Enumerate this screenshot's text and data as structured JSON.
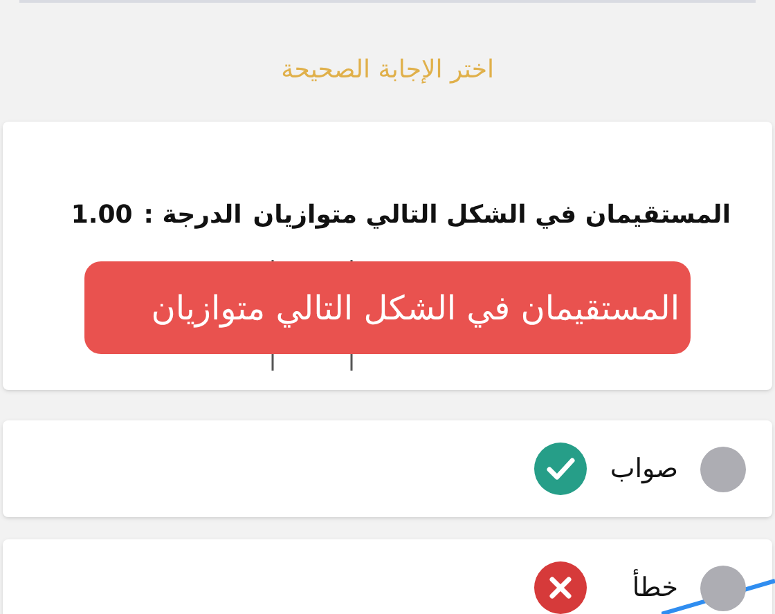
{
  "heading": "اختر الإجابة الصحيحة",
  "question": {
    "text": "المستقيمان في الشكل التالي متوازيان",
    "grade_label": "الدرجة :",
    "grade": "1.00"
  },
  "toast": {
    "text": "المستقيمان في الشكل التالي متوازيان"
  },
  "options": [
    {
      "label": "صواب",
      "selected": false,
      "kind": "correct"
    },
    {
      "label": "خطأ",
      "selected": false,
      "kind": "wrong"
    }
  ]
}
